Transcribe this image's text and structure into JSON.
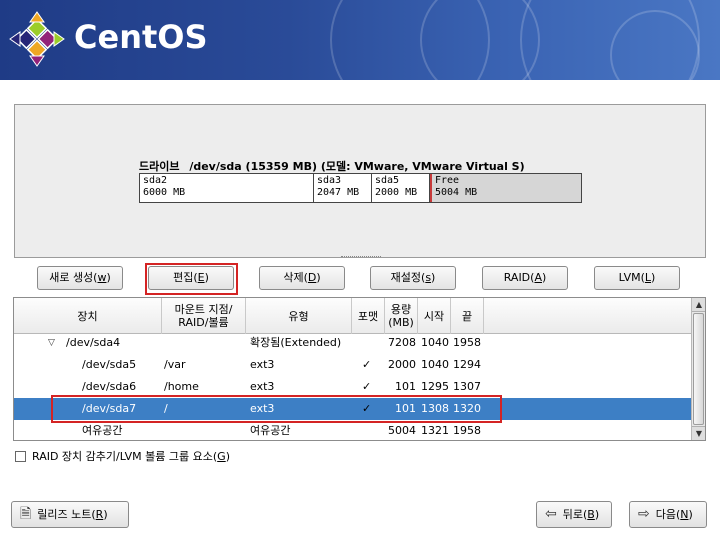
{
  "banner": {
    "logo_text": "CentOS"
  },
  "drive": {
    "label_prefix": "드라이브",
    "label_detail": "/dev/sda (15359 MB) (모델: VMware, VMware Virtual S)",
    "segments": [
      {
        "name": "sda2",
        "size": "6000 MB"
      },
      {
        "name": "sda3",
        "size": "2047 MB"
      },
      {
        "name": "sda5",
        "size": "2000 MB"
      },
      {
        "name": "Free",
        "size": "5004 MB"
      }
    ]
  },
  "actions": {
    "new": {
      "label": "새로 생성(",
      "acc": "w",
      "end": ")"
    },
    "edit": {
      "label": "편집(",
      "acc": "E",
      "end": ")"
    },
    "delete": {
      "label": "삭제(",
      "acc": "D",
      "end": ")"
    },
    "reset": {
      "label": "재설정(",
      "acc": "s",
      "end": ")"
    },
    "raid": {
      "label": "RAID(",
      "acc": "A",
      "end": ")"
    },
    "lvm": {
      "label": "LVM(",
      "acc": "L",
      "end": ")"
    }
  },
  "table": {
    "headers": {
      "device": "장치",
      "mount_line1": "마운트 지점/",
      "mount_line2": "RAID/볼륨",
      "type": "유형",
      "format": "포맷",
      "size_line1": "용량",
      "size_line2": "(MB)",
      "start": "시작",
      "end": "끝"
    },
    "rows": [
      {
        "device": "/dev/sda4",
        "mount": "",
        "type": "확장됨(Extended)",
        "format": "",
        "size": "7208",
        "start": "1040",
        "end": "1958"
      },
      {
        "device": "/dev/sda5",
        "mount": "/var",
        "type": "ext3",
        "format": "✓",
        "size": "2000",
        "start": "1040",
        "end": "1294"
      },
      {
        "device": "/dev/sda6",
        "mount": "/home",
        "type": "ext3",
        "format": "✓",
        "size": "101",
        "start": "1295",
        "end": "1307"
      },
      {
        "device": "/dev/sda7",
        "mount": "/",
        "type": "ext3",
        "format": "✓",
        "size": "101",
        "start": "1308",
        "end": "1320"
      },
      {
        "device": "여유공간",
        "mount": "",
        "type": "여유공간",
        "format": "",
        "size": "5004",
        "start": "1321",
        "end": "1958"
      }
    ]
  },
  "raid_checkbox": {
    "label": "RAID 장치 감추기/LVM 볼륨 그룹 요소(",
    "acc": "G",
    "end": ")"
  },
  "footer": {
    "release_notes": {
      "label": "릴리즈 노트(",
      "acc": "R",
      "end": ")"
    },
    "back": {
      "label": "뒤로(",
      "acc": "B",
      "end": ")"
    },
    "next": {
      "label": "다음(",
      "acc": "N",
      "end": ")"
    }
  }
}
